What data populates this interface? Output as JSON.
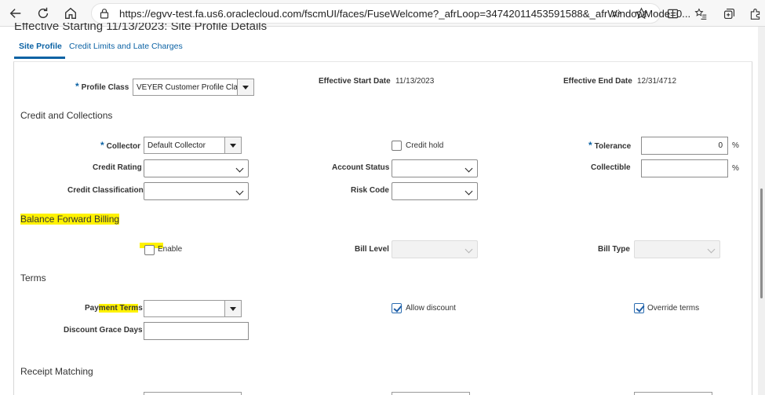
{
  "browser": {
    "url": "https://egvv-test.fa.us6.oraclecloud.com/fscmUI/faces/FuseWelcome?_afrLoop=34742011453591588&_afrWindowMode=0..."
  },
  "page": {
    "heading": "Effective Starting 11/13/2023: Site Profile Details",
    "tabs": [
      {
        "label": "Site Profile",
        "active": true
      },
      {
        "label": "Credit Limits and Late Charges",
        "active": false
      }
    ]
  },
  "profile": {
    "profile_class_label": "Profile Class",
    "profile_class_value": "VEYER Customer Profile Clas",
    "eff_start_label": "Effective Start Date",
    "eff_start_value": "11/13/2023",
    "eff_end_label": "Effective End Date",
    "eff_end_value": "12/31/4712"
  },
  "credit": {
    "title": "Credit and Collections",
    "collector_label": "Collector",
    "collector_value": "Default Collector",
    "credit_hold_label": "Credit hold",
    "credit_hold_checked": false,
    "tolerance_label": "Tolerance",
    "tolerance_value": "0",
    "percent": "%",
    "credit_rating_label": "Credit Rating",
    "account_status_label": "Account Status",
    "collectible_label": "Collectible",
    "credit_class_label": "Credit Classification",
    "risk_code_label": "Risk Code"
  },
  "bfb": {
    "title": "Balance Forward Billing",
    "enable_label": "Enable",
    "enable_checked": false,
    "bill_level_label": "Bill Level",
    "bill_type_label": "Bill Type"
  },
  "terms": {
    "title": "Terms",
    "payment_terms_label_pre": "Pay",
    "payment_terms_label_hl": "ment Term",
    "payment_terms_label_post": "s",
    "allow_discount_label": "Allow discount",
    "allow_discount_checked": true,
    "override_terms_label": "Override terms",
    "override_terms_checked": true,
    "discount_grace_label": "Discount Grace Days"
  },
  "receipt": {
    "title": "Receipt Matching"
  },
  "colors": {
    "link_blue": "#0b62a4",
    "highlight": "#fff200"
  }
}
